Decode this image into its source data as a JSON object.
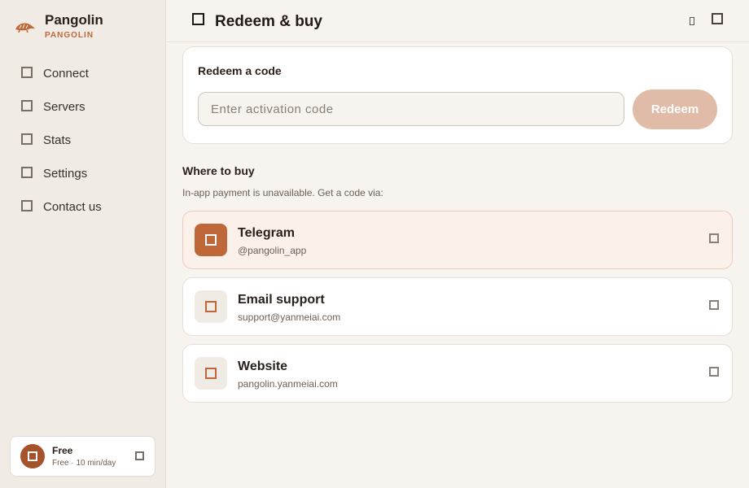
{
  "brand": {
    "name": "Pangolin",
    "subtitle": "PANGOLIN"
  },
  "sidebar": {
    "items": [
      {
        "label": "Connect",
        "icon": "connect-icon"
      },
      {
        "label": "Servers",
        "icon": "servers-icon"
      },
      {
        "label": "Stats",
        "icon": "stats-icon"
      },
      {
        "label": "Settings",
        "icon": "settings-icon"
      },
      {
        "label": "Contact us",
        "icon": "contact-icon"
      }
    ]
  },
  "plan": {
    "name": "Free",
    "detail": "Free · 10 min/day"
  },
  "header": {
    "title": "Redeem & buy"
  },
  "redeem": {
    "title": "Redeem a code",
    "placeholder": "Enter activation code",
    "button": "Redeem"
  },
  "buy": {
    "title": "Where to buy",
    "subtitle": "In-app payment is unavailable. Get a code via:",
    "items": [
      {
        "title": "Telegram",
        "subtitle": "@pangolin_app",
        "icon": "telegram-icon"
      },
      {
        "title": "Email support",
        "subtitle": "support@yanmeiai.com",
        "icon": "email-icon"
      },
      {
        "title": "Website",
        "subtitle": "pangolin.yanmeiai.com",
        "icon": "website-icon"
      }
    ]
  },
  "colors": {
    "accent": "#c0673a",
    "accent_dark": "#a6532b",
    "button_disabled": "#e0bba7",
    "highlight_bg": "#fbf0ea"
  }
}
